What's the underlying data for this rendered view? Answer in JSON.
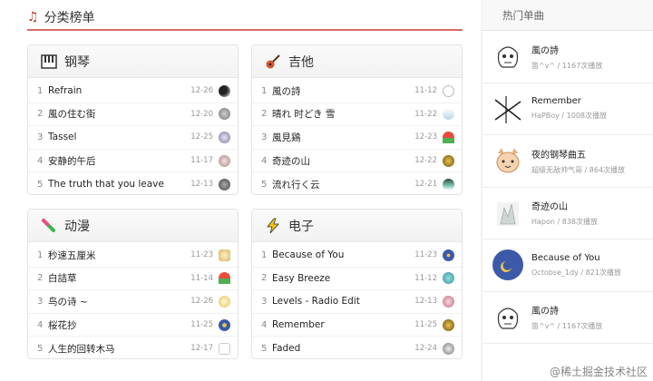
{
  "section": {
    "title": "分类榜单"
  },
  "categories": [
    {
      "name": "钢琴",
      "songs": [
        {
          "idx": "1",
          "title": "Refrain",
          "date": "12-26"
        },
        {
          "idx": "2",
          "title": "風の住む街",
          "date": "12-20"
        },
        {
          "idx": "3",
          "title": "Tassel",
          "date": "12-25"
        },
        {
          "idx": "4",
          "title": "安静的午后",
          "date": "11-17"
        },
        {
          "idx": "5",
          "title": "The truth that you leave",
          "date": "12-13"
        }
      ]
    },
    {
      "name": "吉他",
      "songs": [
        {
          "idx": "1",
          "title": "風の詩",
          "date": "11-12"
        },
        {
          "idx": "2",
          "title": "晴れ 时どき 雪",
          "date": "11-22"
        },
        {
          "idx": "3",
          "title": "風見鶏",
          "date": "12-23"
        },
        {
          "idx": "4",
          "title": "奇迹の山",
          "date": "12-22"
        },
        {
          "idx": "5",
          "title": "流れ行く云",
          "date": "12-21"
        }
      ]
    },
    {
      "name": "动漫",
      "songs": [
        {
          "idx": "1",
          "title": "秒速五厘米",
          "date": "11-23"
        },
        {
          "idx": "2",
          "title": "白詰草",
          "date": "11-14"
        },
        {
          "idx": "3",
          "title": "鸟の诗 ~",
          "date": "12-26"
        },
        {
          "idx": "4",
          "title": "桜花抄",
          "date": "11-25"
        },
        {
          "idx": "5",
          "title": "人生的回转木马",
          "date": "12-17"
        }
      ]
    },
    {
      "name": "电子",
      "songs": [
        {
          "idx": "1",
          "title": "Because of You",
          "date": "11-23"
        },
        {
          "idx": "2",
          "title": "Easy Breeze",
          "date": "11-12"
        },
        {
          "idx": "3",
          "title": "Levels - Radio Edit",
          "date": "12-13"
        },
        {
          "idx": "4",
          "title": "Remember",
          "date": "11-25"
        },
        {
          "idx": "5",
          "title": "Faded",
          "date": "12-24"
        }
      ]
    }
  ],
  "sidebar": {
    "title": "热门单曲",
    "items": [
      {
        "title": "風の詩",
        "meta": "笛^v^ / 1167次播放"
      },
      {
        "title": "Remember",
        "meta": "HaPBoy / 1008次播放"
      },
      {
        "title": "夜的钢琴曲五",
        "meta": "超级无敌帅气哥 / 864次播放"
      },
      {
        "title": "奇迹の山",
        "meta": "Hapon / 838次播放"
      },
      {
        "title": "Because of You",
        "meta": "Octobse_1dy / 821次播放"
      },
      {
        "title": "風の詩",
        "meta": "笛^v^ / 1167次播放"
      }
    ]
  },
  "watermark": "@稀土掘金技术社区",
  "colors": {
    "accent": "#d96a6a"
  },
  "icons": {
    "section": "music-note-icon",
    "piano": "piano-icon",
    "guitar": "guitar-icon",
    "anime": "anime-pen-icon",
    "electronic": "lightning-icon"
  }
}
